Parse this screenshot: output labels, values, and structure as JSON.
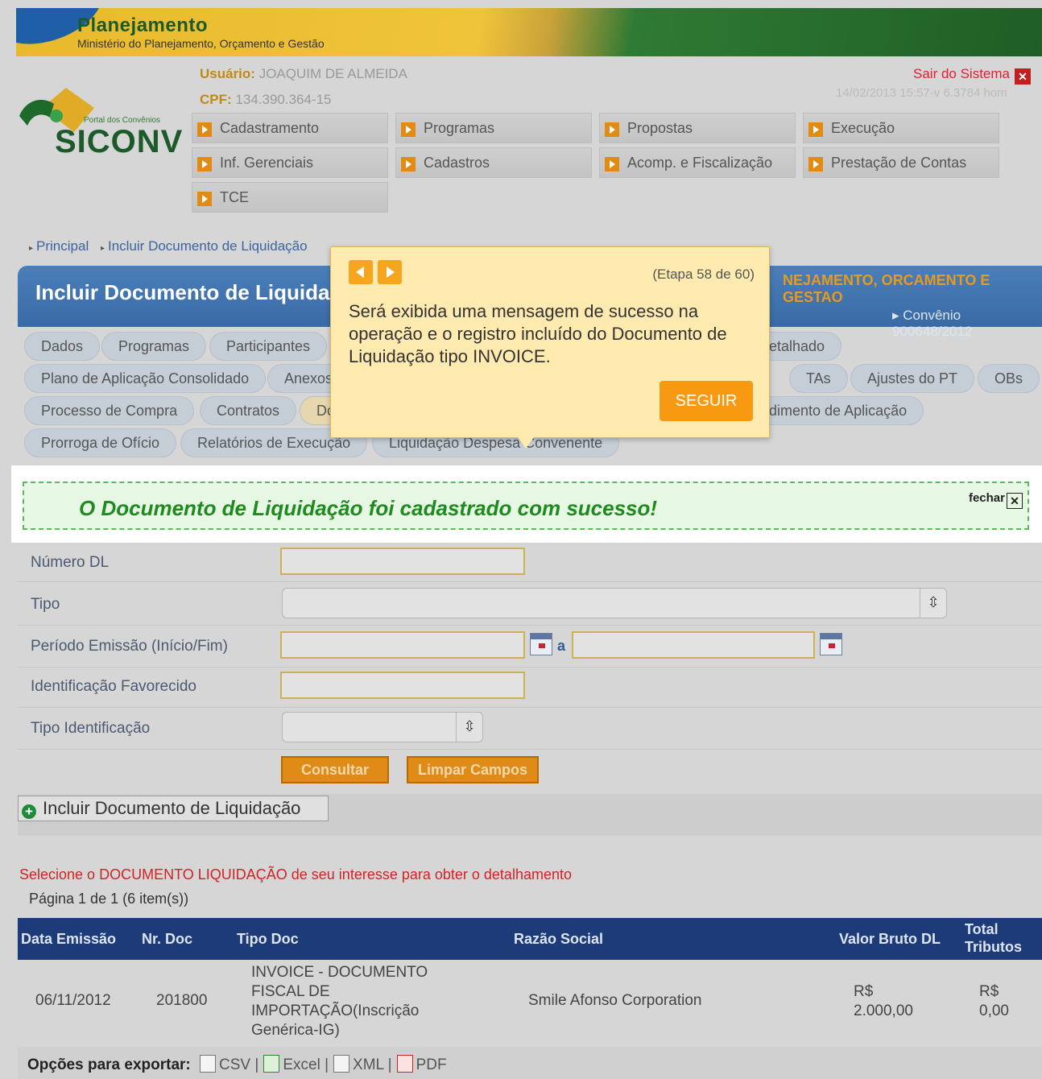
{
  "banner": {
    "title": "Planejamento",
    "subtitle": "Ministério do Planejamento, Orçamento e Gestão"
  },
  "logo": {
    "portal": "Portal dos Convênios",
    "name": "SICONV"
  },
  "user": {
    "label": "Usuário:",
    "name": "JOAQUIM DE ALMEIDA",
    "cpf_label": "CPF:",
    "cpf": "134.390.364-15"
  },
  "logout": "Sair do Sistema",
  "version": "14/02/2013 15:57-v 6.3784 hom",
  "menu": [
    "Cadastramento",
    "Programas",
    "Propostas",
    "Execução",
    "Inf. Gerenciais",
    "Cadastros",
    "Acomp. e Fiscalização",
    "Prestação de Contas",
    "TCE"
  ],
  "breadcrumb": [
    "Principal",
    "Incluir Documento de Liquidação"
  ],
  "page_title": "Incluir Documento de Liquida",
  "org": "NEJAMENTO, ORCAMENTO E GESTAO",
  "convenio": "Convênio 900648/2012",
  "tabs": [
    "Dados",
    "Programas",
    "Participantes",
    "etalhado",
    "Plano de Aplicação Consolidado",
    "Anexos",
    "TAs",
    "Ajustes do PT",
    "OBs",
    "Processo de Compra",
    "Contratos",
    "Dc",
    "dimento de Aplicação",
    "Prorroga de Ofício",
    "Relatórios de Execução",
    "Liquidação Despesa Convenente"
  ],
  "success": {
    "message": "O Documento de Liquidação foi cadastrado com sucesso!",
    "close": "fechar"
  },
  "form": {
    "numero_dl": "Número DL",
    "tipo": "Tipo",
    "periodo": "Período Emissão (Início/Fim)",
    "periodo_sep": "a",
    "ident_favorecido": "Identificação Favorecido",
    "tipo_ident": "Tipo Identificação",
    "consultar": "Consultar",
    "limpar": "Limpar Campos"
  },
  "add_button": "Incluir Documento de Liquidação",
  "select_msg": "Selecione o DOCUMENTO LIQUIDAÇÃO de seu interesse para obter o detalhamento",
  "page_info": "Página 1 de 1 (6 item(s))",
  "table": {
    "headers": [
      "Data Emissão",
      "Nr. Doc",
      "Tipo Doc",
      "Razão Social",
      "Valor Bruto DL",
      "Total",
      "Tributos"
    ],
    "row": {
      "data": "06/11/2012",
      "nr": "201800",
      "tipo_lines": [
        "INVOICE - DOCUMENTO",
        "FISCAL DE",
        "IMPORTAÇÃO(Inscrição",
        "Genérica-IG)"
      ],
      "razao": "Smile Afonso Corporation",
      "valor_lines": [
        "R$",
        "2.000,00"
      ],
      "trib_lines": [
        "R$",
        "0,00"
      ]
    }
  },
  "export": {
    "label": "Opções para exportar:",
    "csv": "CSV",
    "excel": "Excel",
    "xml": "XML",
    "pdf": "PDF"
  },
  "popup": {
    "step": "(Etapa 58 de 60)",
    "text": "Será exibida uma mensagem de sucesso na operação e o registro incluído do Documento de Liquidação tipo INVOICE.",
    "button": "SEGUIR"
  }
}
